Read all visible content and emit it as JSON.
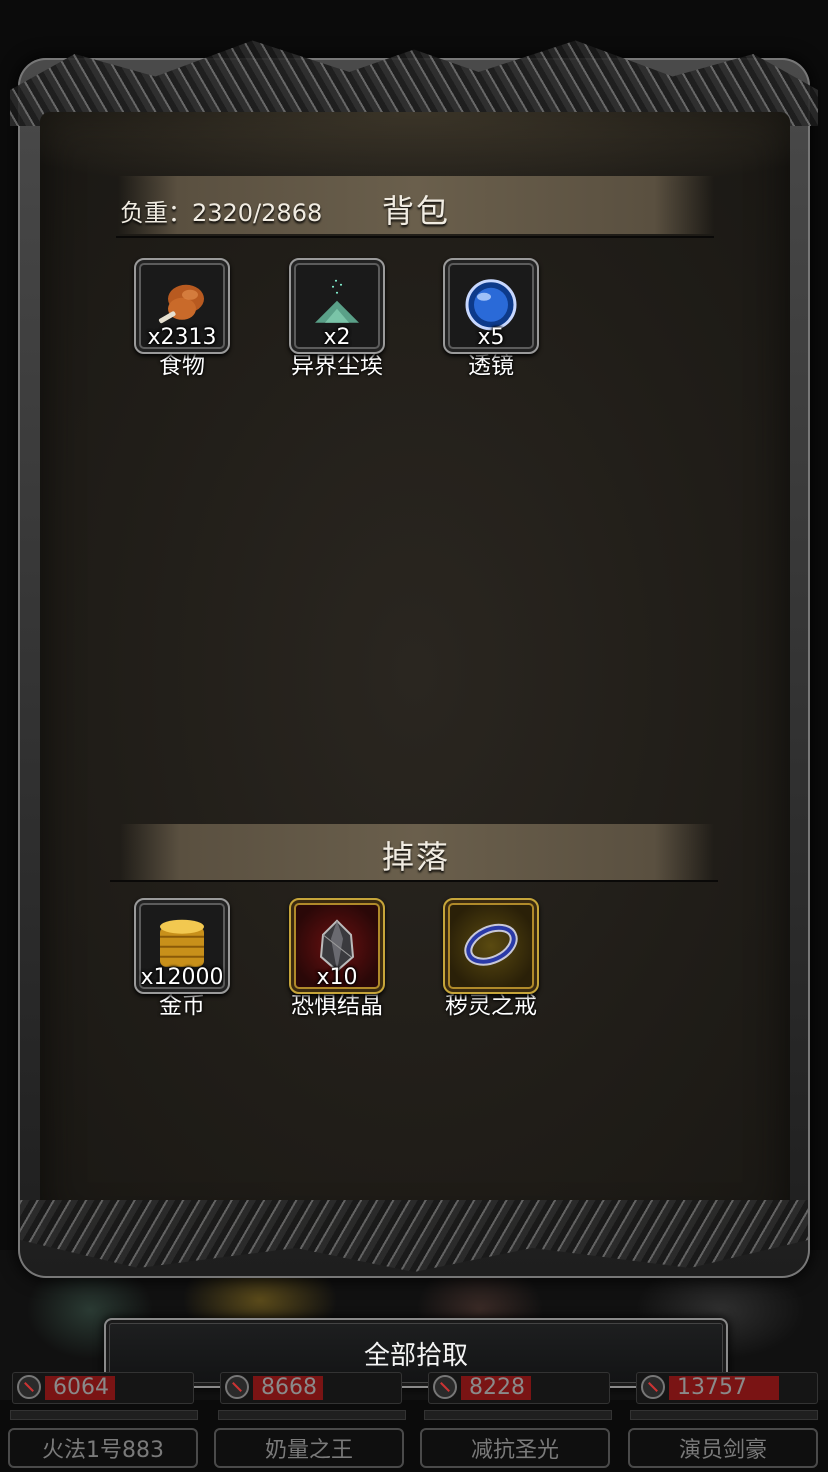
{
  "inventory": {
    "title": "背包",
    "weight_label": "负重：2320/2868",
    "items": [
      {
        "name": "食物",
        "count": "x2313",
        "icon": "roast-meat-icon"
      },
      {
        "name": "异界尘埃",
        "count": "x2",
        "icon": "dust-pile-icon"
      },
      {
        "name": "透镜",
        "count": "x5",
        "icon": "blue-lens-icon"
      }
    ]
  },
  "drops": {
    "title": "掉落",
    "items": [
      {
        "name": "金币",
        "count": "x12000",
        "icon": "gold-coins-icon"
      },
      {
        "name": "恐惧结晶",
        "count": "x10",
        "icon": "dark-crystal-icon"
      },
      {
        "name": "秽灵之戒",
        "count": "",
        "icon": "dark-ring-icon"
      }
    ]
  },
  "actions": {
    "pickup_all": "全部拾取"
  },
  "party": [
    {
      "hp": "6064",
      "name": "火法1号883"
    },
    {
      "hp": "8668",
      "name": "奶量之王"
    },
    {
      "hp": "8228",
      "name": "减抗圣光"
    },
    {
      "hp": "13757",
      "name": "演员剑豪"
    }
  ],
  "colors": {
    "panel": "#201d18",
    "section_bar": "#6a5f4c",
    "gold_border": "#c6a53a",
    "hp_fill": "#7a1414"
  }
}
